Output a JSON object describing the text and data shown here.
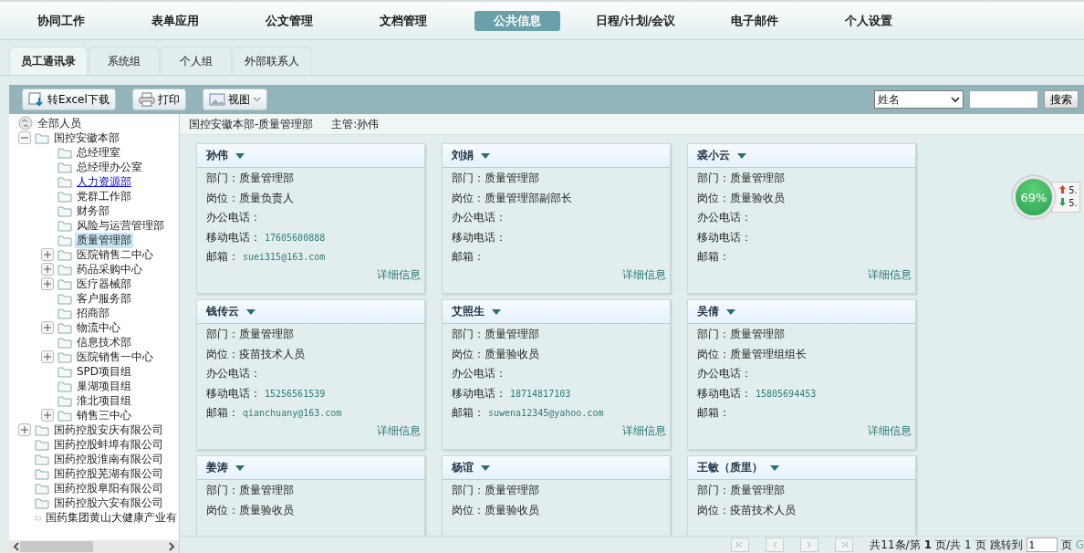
{
  "nav": {
    "items": [
      {
        "label": "协同工作",
        "selected": false
      },
      {
        "label": "表单应用",
        "selected": false
      },
      {
        "label": "公文管理",
        "selected": false
      },
      {
        "label": "文档管理",
        "selected": false
      },
      {
        "label": "公共信息",
        "selected": true
      },
      {
        "label": "日程/计划/会议",
        "selected": false
      },
      {
        "label": "电子邮件",
        "selected": false
      },
      {
        "label": "个人设置",
        "selected": false
      }
    ]
  },
  "tabs": [
    {
      "label": "员工通讯录",
      "selected": true
    },
    {
      "label": "系统组",
      "selected": false
    },
    {
      "label": "个人组",
      "selected": false
    },
    {
      "label": "外部联系人",
      "selected": false
    }
  ],
  "toolbar": {
    "buttons": [
      {
        "kind": "excel",
        "label": "转Excel下载"
      },
      {
        "kind": "print",
        "label": "打印"
      },
      {
        "kind": "view",
        "label": "视图"
      }
    ],
    "search": {
      "field": "姓名",
      "button": "搜索"
    }
  },
  "tree": {
    "label": "全部人员",
    "selected": false,
    "hovered": false,
    "children": [
      {
        "label": "国控安徽本部",
        "expanded": true,
        "selected": false,
        "hovered": false,
        "children": [
          {
            "label": "总经理室",
            "selected": false,
            "hovered": false
          },
          {
            "label": "总经理办公室",
            "selected": false,
            "hovered": false
          },
          {
            "label": "人力资源部",
            "selected": false,
            "hovered": true
          },
          {
            "label": "党群工作部",
            "selected": false,
            "hovered": false
          },
          {
            "label": "财务部",
            "selected": false,
            "hovered": false
          },
          {
            "label": "风险与运营管理部",
            "selected": false,
            "hovered": false
          },
          {
            "label": "质量管理部",
            "selected": true,
            "hovered": false
          },
          {
            "label": "医院销售二中心",
            "expanded": false,
            "selected": false,
            "hovered": false
          },
          {
            "label": "药品采购中心",
            "expanded": false,
            "selected": false,
            "hovered": false
          },
          {
            "label": "医疗器械部",
            "expanded": false,
            "selected": false,
            "hovered": false
          },
          {
            "label": "客户服务部",
            "selected": false,
            "hovered": false
          },
          {
            "label": "招商部",
            "selected": false,
            "hovered": false
          },
          {
            "label": "物流中心",
            "expanded": false,
            "selected": false,
            "hovered": false
          },
          {
            "label": "信息技术部",
            "selected": false,
            "hovered": false
          },
          {
            "label": "医院销售一中心",
            "expanded": false,
            "selected": false,
            "hovered": false
          },
          {
            "label": "SPD项目组",
            "selected": false,
            "hovered": false
          },
          {
            "label": "巢湖项目组",
            "selected": false,
            "hovered": false
          },
          {
            "label": "淮北项目组",
            "selected": false,
            "hovered": false
          },
          {
            "label": "销售三中心",
            "expanded": false,
            "selected": false,
            "hovered": false
          }
        ]
      },
      {
        "label": "国药控股安庆有限公司",
        "expanded": false,
        "selected": false,
        "hovered": false
      },
      {
        "label": "国药控股蚌埠有限公司",
        "selected": false,
        "hovered": false
      },
      {
        "label": "国药控股淮南有限公司",
        "selected": false,
        "hovered": false
      },
      {
        "label": "国药控股芜湖有限公司",
        "selected": false,
        "hovered": false
      },
      {
        "label": "国药控股阜阳有限公司",
        "selected": false,
        "hovered": false
      },
      {
        "label": "国药控股六安有限公司",
        "selected": false,
        "hovered": false
      },
      {
        "label": "国药集团黄山大健康产业有",
        "selected": false,
        "hovered": false
      }
    ]
  },
  "breadcrumb": {
    "path": "国控安徽本部-质量管理部",
    "manager": "主管:孙伟"
  },
  "cards": [
    {
      "name": "孙伟",
      "fields": [
        {
          "label": "部门：",
          "value": "质量管理部",
          "kind": "text"
        },
        {
          "label": "岗位：",
          "value": "质量负责人",
          "kind": "text"
        },
        {
          "label": "办公电话："
        },
        {
          "label": "移动电话：",
          "value": "17605600888",
          "kind": "contact"
        },
        {
          "label": "邮箱：",
          "value": "suei315@163.com",
          "kind": "contact"
        }
      ],
      "link": "详细信息"
    },
    {
      "name": "刘娟",
      "fields": [
        {
          "label": "部门：",
          "value": "质量管理部",
          "kind": "text"
        },
        {
          "label": "岗位：",
          "value": "质量管理部副部长",
          "kind": "text"
        },
        {
          "label": "办公电话："
        },
        {
          "label": "移动电话："
        },
        {
          "label": "邮箱："
        }
      ],
      "link": "详细信息"
    },
    {
      "name": "裘小云",
      "fields": [
        {
          "label": "部门：",
          "value": "质量管理部",
          "kind": "text"
        },
        {
          "label": "岗位：",
          "value": "质量验收员",
          "kind": "text"
        },
        {
          "label": "办公电话："
        },
        {
          "label": "移动电话："
        },
        {
          "label": "邮箱："
        }
      ],
      "link": "详细信息"
    },
    {
      "name": "钱传云",
      "fields": [
        {
          "label": "部门：",
          "value": "质量管理部",
          "kind": "text"
        },
        {
          "label": "岗位：",
          "value": "疫苗技术人员",
          "kind": "text"
        },
        {
          "label": "办公电话："
        },
        {
          "label": "移动电话：",
          "value": "15256561539",
          "kind": "contact"
        },
        {
          "label": "邮箱：",
          "value": "qianchuany@163.com",
          "kind": "contact"
        }
      ],
      "link": "详细信息"
    },
    {
      "name": "艾照生",
      "fields": [
        {
          "label": "部门：",
          "value": "质量管理部",
          "kind": "text"
        },
        {
          "label": "岗位：",
          "value": "质量验收员",
          "kind": "text"
        },
        {
          "label": "办公电话："
        },
        {
          "label": "移动电话：",
          "value": "18714817103",
          "kind": "contact"
        },
        {
          "label": "邮箱：",
          "value": "suwena12345@yahoo.com",
          "kind": "contact"
        }
      ],
      "link": "详细信息"
    },
    {
      "name": "吴倩",
      "fields": [
        {
          "label": "部门：",
          "value": "质量管理部",
          "kind": "text"
        },
        {
          "label": "岗位：",
          "value": "质量管理组组长",
          "kind": "text"
        },
        {
          "label": "办公电话："
        },
        {
          "label": "移动电话：",
          "value": "15805694453",
          "kind": "contact"
        },
        {
          "label": "邮箱："
        }
      ],
      "link": "详细信息"
    },
    {
      "name": "姜涛",
      "fields": [
        {
          "label": "部门：",
          "value": "质量管理部",
          "kind": "text"
        },
        {
          "label": "岗位：",
          "value": "质量验收员",
          "kind": "text"
        }
      ]
    },
    {
      "name": "杨谊",
      "fields": [
        {
          "label": "部门：",
          "value": "质量管理部",
          "kind": "text"
        },
        {
          "label": "岗位：",
          "value": "质量验收员",
          "kind": "text"
        }
      ]
    },
    {
      "name": "王敏（质里）",
      "fields": [
        {
          "label": "部门：",
          "value": "质量管理部",
          "kind": "text"
        },
        {
          "label": "岗位：",
          "value": "疫苗技术人员",
          "kind": "text"
        }
      ]
    }
  ],
  "pagination": {
    "total": "共11条/第",
    "page": "1",
    "of": "页/共",
    "pages": "1",
    "unit": "页",
    "jump": "跳转到",
    "jump_value": "1",
    "jump_unit": "页",
    "go": "G"
  },
  "speed_widget": {
    "percent": "69%",
    "up": "5.",
    "down": "5."
  }
}
